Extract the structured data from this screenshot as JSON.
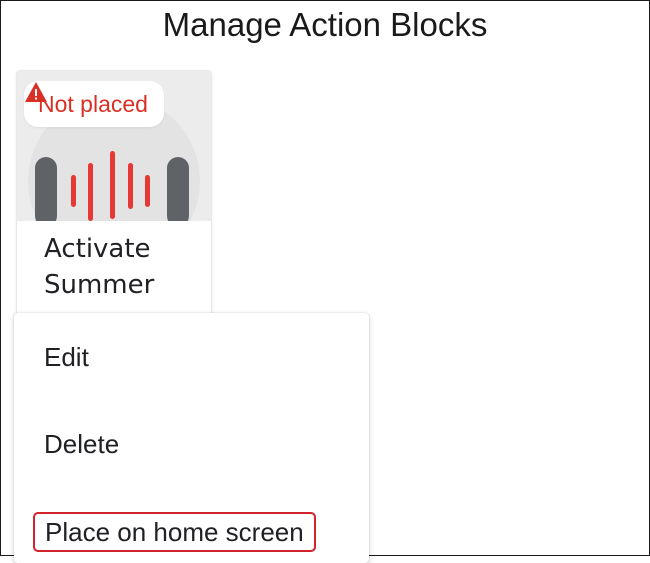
{
  "page": {
    "title": "Manage Action Blocks"
  },
  "card": {
    "status": "Not placed",
    "title_line1": "Activate",
    "title_line2": "Summer",
    "accent_color": "#d93025",
    "bar_color": "#e53935",
    "speaker_color": "#5f6368"
  },
  "menu": {
    "items": [
      {
        "label": "Edit"
      },
      {
        "label": "Delete"
      },
      {
        "label": "Place on home screen"
      }
    ],
    "highlight_color": "#d0232b"
  }
}
